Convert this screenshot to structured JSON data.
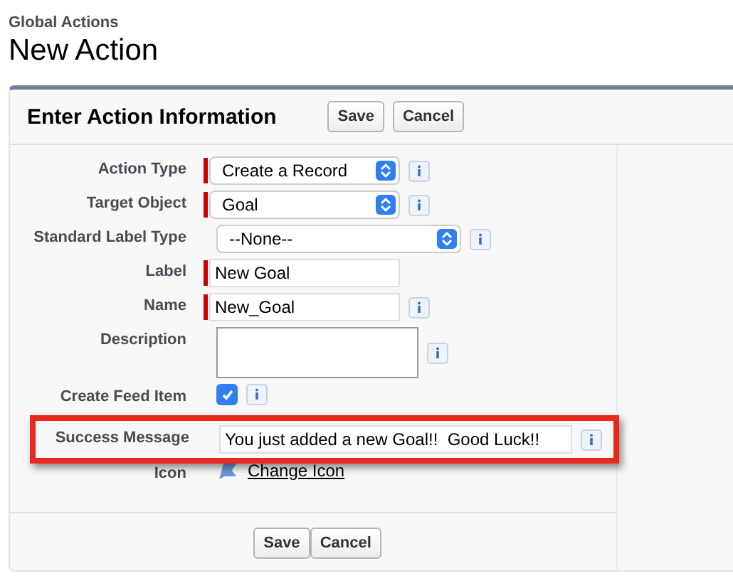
{
  "breadcrumb": "Global Actions",
  "title": "New Action",
  "panel": {
    "title": "Enter Action Information",
    "top_buttons": [
      "Save",
      "Cancel"
    ],
    "fields": [
      {
        "label": "Action Type",
        "kind": "select",
        "value": "Create a Record",
        "required": true,
        "info": true,
        "highlighted": false
      },
      {
        "label": "Target Object",
        "kind": "select",
        "value": "Goal",
        "required": true,
        "info": true,
        "highlighted": false
      },
      {
        "label": "Standard Label Type",
        "kind": "select-wide",
        "value": "--None--",
        "required": false,
        "info": true,
        "highlighted": false
      },
      {
        "label": "Label",
        "kind": "text",
        "value": "New Goal",
        "required": true,
        "info": false,
        "highlighted": false
      },
      {
        "label": "Name",
        "kind": "text",
        "value": "New_Goal",
        "required": true,
        "info": true,
        "highlighted": false
      },
      {
        "label": "Description",
        "kind": "textarea",
        "required": false,
        "info": true,
        "highlighted": false
      },
      {
        "label": "Create Feed Item",
        "kind": "checkbox",
        "checked": true,
        "required": false,
        "info": true,
        "highlighted": false
      },
      {
        "label": "Success Message",
        "kind": "text-wide",
        "value": "You just added a new Goal!!  Good Luck!!",
        "required": false,
        "info": true,
        "highlighted": true
      },
      {
        "label": "Icon",
        "kind": "icon-link",
        "link": "Change Icon",
        "required": false,
        "info": false,
        "highlighted": false
      }
    ],
    "bottom_buttons": [
      "Save",
      "Cancel"
    ]
  }
}
